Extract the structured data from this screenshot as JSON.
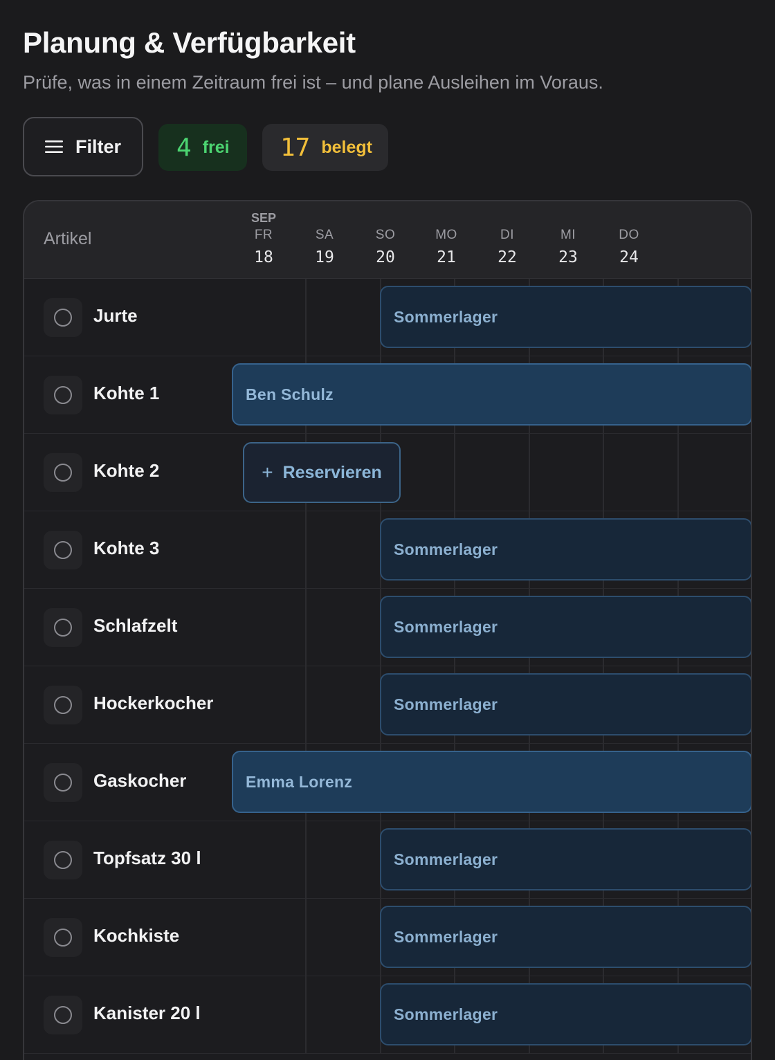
{
  "header": {
    "title": "Planung & Verfügbarkeit",
    "subtitle": "Prüfe, was in einem Zeitraum frei ist – und plane Ausleihen im Voraus."
  },
  "toolbar": {
    "filter_label": "Filter",
    "free_count": "4",
    "free_label": "frei",
    "busy_count": "17",
    "busy_label": "belegt"
  },
  "colors": {
    "free": "#4cd471",
    "busy": "#f2bf3a",
    "booking_camp": "#172739",
    "booking_person": "#1e3c59"
  },
  "table": {
    "article_header": "Artikel",
    "month": "SEP",
    "days": [
      {
        "weekday": "FR",
        "date": "18"
      },
      {
        "weekday": "SA",
        "date": "19"
      },
      {
        "weekday": "SO",
        "date": "20"
      },
      {
        "weekday": "MO",
        "date": "21"
      },
      {
        "weekday": "DI",
        "date": "22"
      },
      {
        "weekday": "MI",
        "date": "23"
      },
      {
        "weekday": "DO",
        "date": "24"
      }
    ],
    "reserve_label": "Reservieren",
    "rows": [
      {
        "name": "Jurte",
        "booking": "Sommerlager",
        "kind": "camp"
      },
      {
        "name": "Kohte 1",
        "booking": "Ben Schulz",
        "kind": "person"
      },
      {
        "name": "Kohte 2",
        "booking": "",
        "kind": "free"
      },
      {
        "name": "Kohte 3",
        "booking": "Sommerlager",
        "kind": "camp"
      },
      {
        "name": "Schlafzelt",
        "booking": "Sommerlager",
        "kind": "camp"
      },
      {
        "name": "Hockerkocher",
        "booking": "Sommerlager",
        "kind": "camp"
      },
      {
        "name": "Gaskocher",
        "booking": "Emma Lorenz",
        "kind": "person"
      },
      {
        "name": "Topfsatz 30 l",
        "booking": "Sommerlager",
        "kind": "camp"
      },
      {
        "name": "Kochkiste",
        "booking": "Sommerlager",
        "kind": "camp"
      },
      {
        "name": "Kanister 20 l",
        "booking": "Sommerlager",
        "kind": "camp"
      }
    ]
  }
}
